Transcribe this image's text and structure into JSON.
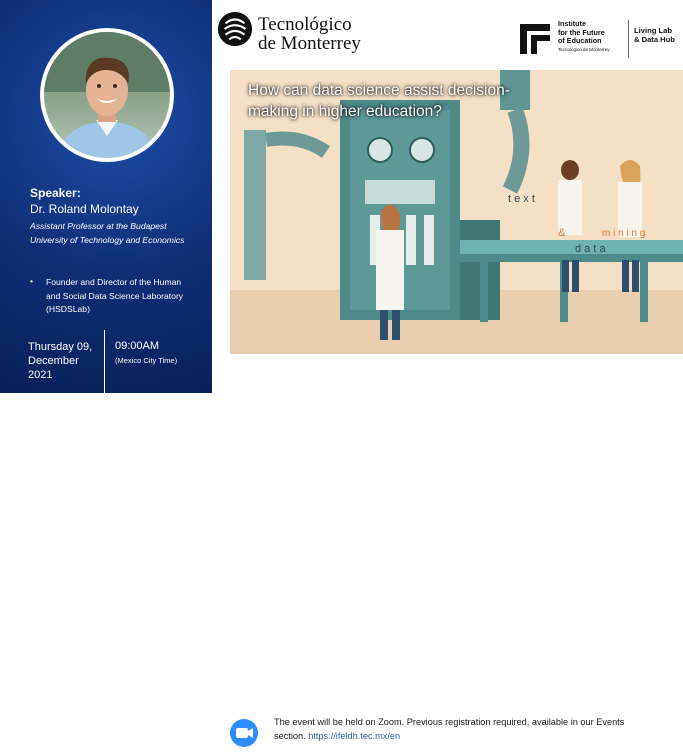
{
  "speaker": {
    "label": "Speaker:",
    "name": "Dr. Roland Molontay",
    "title": "Assistant Professor at the Budapest University of Technology and Economics",
    "bullet_symbol": "•",
    "bullet_text": "Founder and Director of the Human and Social Data Science Laboratory (HSDSLab)"
  },
  "schedule": {
    "date": "Thursday 09, December 2021",
    "time": "09:00AM",
    "timezone": "(Mexico City Time)"
  },
  "header": {
    "university_line1": "Tecnológico",
    "university_line2": "de Monterrey",
    "institute_line1": "Institute",
    "institute_line2": "for the Future",
    "institute_line3": "of Education",
    "institute_sub": "Tecnológico de Monterrey",
    "livinglab_line1": "Living Lab",
    "livinglab_line2": "& Data Hub"
  },
  "banner": {
    "headline": "How can data science assist decision-making in higher education?",
    "belt_words": {
      "text": "t e x t",
      "amp": "&",
      "mining": "m i n i n g",
      "data": "d a t a"
    },
    "colors": {
      "background": "#f4e0c6",
      "machine": "#4d8a88",
      "belt": "#6db3b3"
    }
  },
  "footer": {
    "line1": "The event will be held on Zoom. Previous registration required, available in our Events",
    "line2_prefix": "section.",
    "link": "https://ifeldh.tec.mx/en",
    "zoom_color": "#2d8cff"
  },
  "colors": {
    "left_panel": "#0d2d74",
    "text_on_dark": "#ffffff"
  }
}
